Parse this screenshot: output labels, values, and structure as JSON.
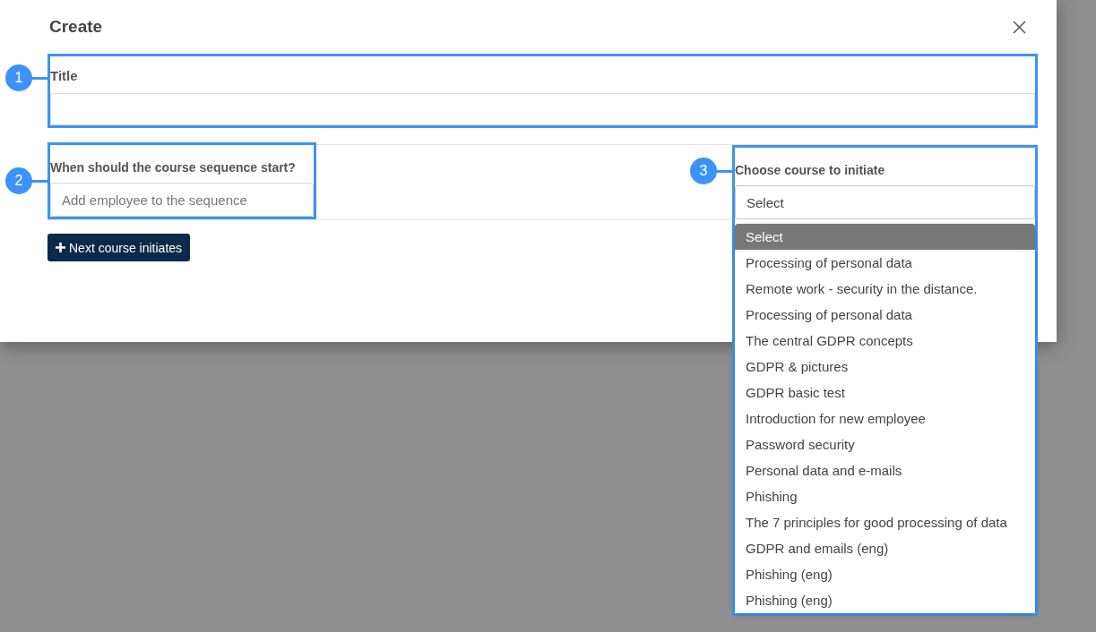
{
  "dialog": {
    "title": "Create"
  },
  "title_field": {
    "callout": "1",
    "label": "Title"
  },
  "start_field": {
    "callout": "2",
    "label": "When should the course sequence start?",
    "placeholder": "Add employee to the sequence"
  },
  "course_field": {
    "callout": "3",
    "label": "Choose course to initiate",
    "value": "Select",
    "options": [
      {
        "label": "Select",
        "selected": true
      },
      {
        "label": "Processing of personal data",
        "selected": false
      },
      {
        "label": "Remote work - security in the distance.",
        "selected": false
      },
      {
        "label": "Processing of personal data",
        "selected": false
      },
      {
        "label": "The central GDPR concepts",
        "selected": false
      },
      {
        "label": "GDPR & pictures",
        "selected": false
      },
      {
        "label": "GDPR basic test",
        "selected": false
      },
      {
        "label": "Introduction for new employee",
        "selected": false
      },
      {
        "label": "Password security",
        "selected": false
      },
      {
        "label": "Personal data and e-mails",
        "selected": false
      },
      {
        "label": "Phishing",
        "selected": false
      },
      {
        "label": "The 7 principles for good processing of data",
        "selected": false
      },
      {
        "label": "GDPR and emails (eng)",
        "selected": false
      },
      {
        "label": "Phishing (eng)",
        "selected": false
      },
      {
        "label": "Phishing (eng)",
        "selected": false
      }
    ]
  },
  "add_button": {
    "label": "Next course initiates"
  }
}
